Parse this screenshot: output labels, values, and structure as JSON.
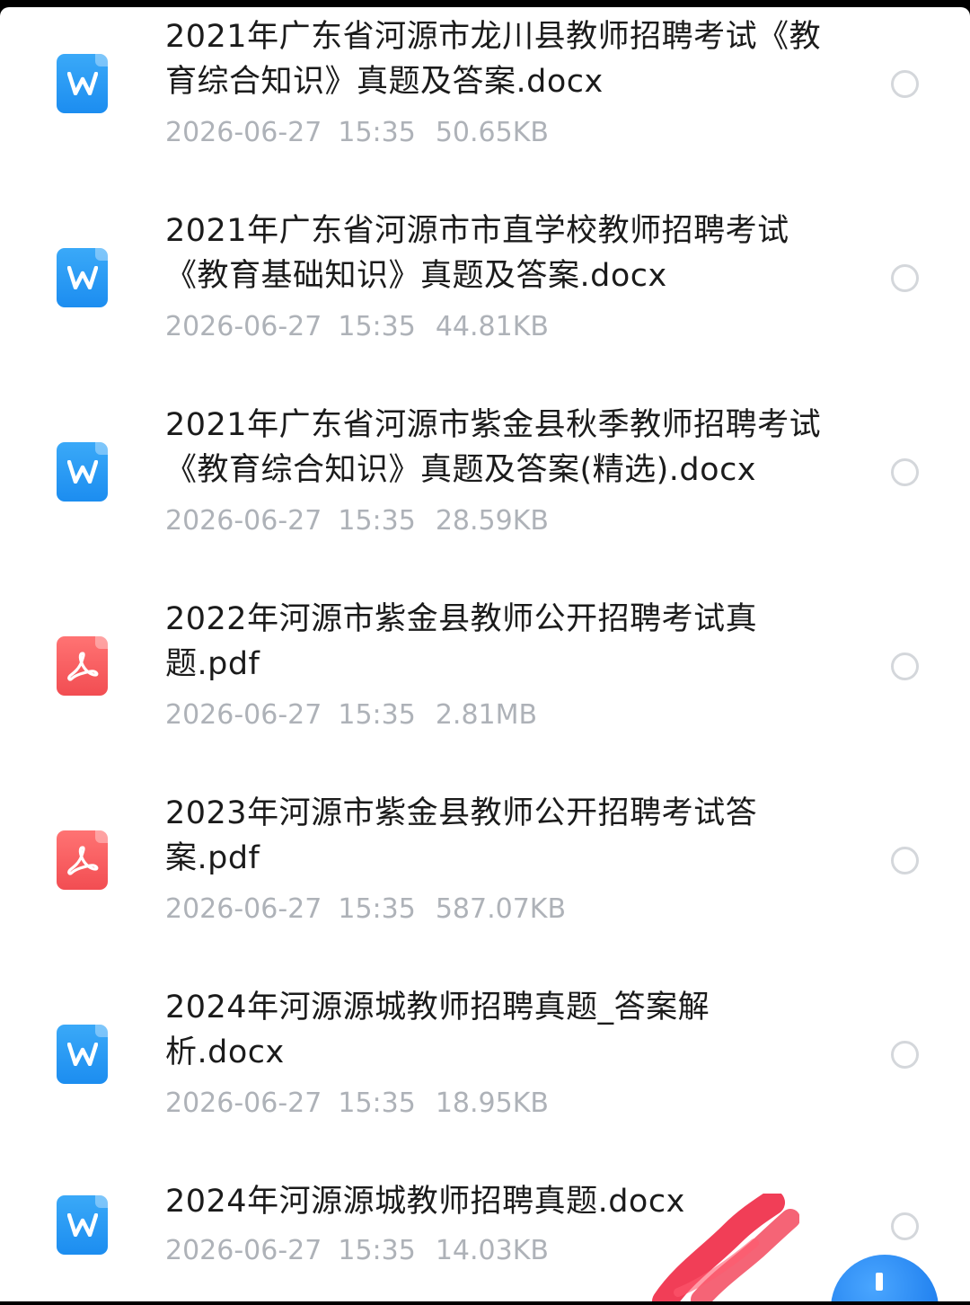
{
  "files": [
    {
      "type": "word",
      "icon": "word-icon",
      "name": "2021年广东省河源市龙川县教师招聘考试《教育综合知识》真题及答案.docx",
      "date": "2026-06-27",
      "time": "15:35",
      "size": "50.65KB"
    },
    {
      "type": "word",
      "icon": "word-icon",
      "name": "2021年广东省河源市市直学校教师招聘考试《教育基础知识》真题及答案.docx",
      "date": "2026-06-27",
      "time": "15:35",
      "size": "44.81KB"
    },
    {
      "type": "word",
      "icon": "word-icon",
      "name": "2021年广东省河源市紫金县秋季教师招聘考试《教育综合知识》真题及答案(精选).docx",
      "date": "2026-06-27",
      "time": "15:35",
      "size": "28.59KB"
    },
    {
      "type": "pdf",
      "icon": "pdf-icon",
      "name": "2022年河源市紫金县教师公开招聘考试真题.pdf",
      "date": "2026-06-27",
      "time": "15:35",
      "size": "2.81MB"
    },
    {
      "type": "pdf",
      "icon": "pdf-icon",
      "name": "2023年河源市紫金县教师公开招聘考试答案.pdf",
      "date": "2026-06-27",
      "time": "15:35",
      "size": "587.07KB"
    },
    {
      "type": "word",
      "icon": "word-icon",
      "name": "2024年河源源城教师招聘真题_答案解析.docx",
      "date": "2026-06-27",
      "time": "15:35",
      "size": "18.95KB"
    },
    {
      "type": "word",
      "icon": "word-icon",
      "name": "2024年河源源城教师招聘真题.docx",
      "date": "2026-06-27",
      "time": "15:35",
      "size": "14.03KB"
    }
  ],
  "colors": {
    "word_icon": "#1c8df0",
    "pdf_icon": "#f24d52",
    "meta_text": "#aeb2b8",
    "name_text": "#1b1b1b",
    "fab": "#1f7fee"
  },
  "fab_icon": "plus-icon"
}
